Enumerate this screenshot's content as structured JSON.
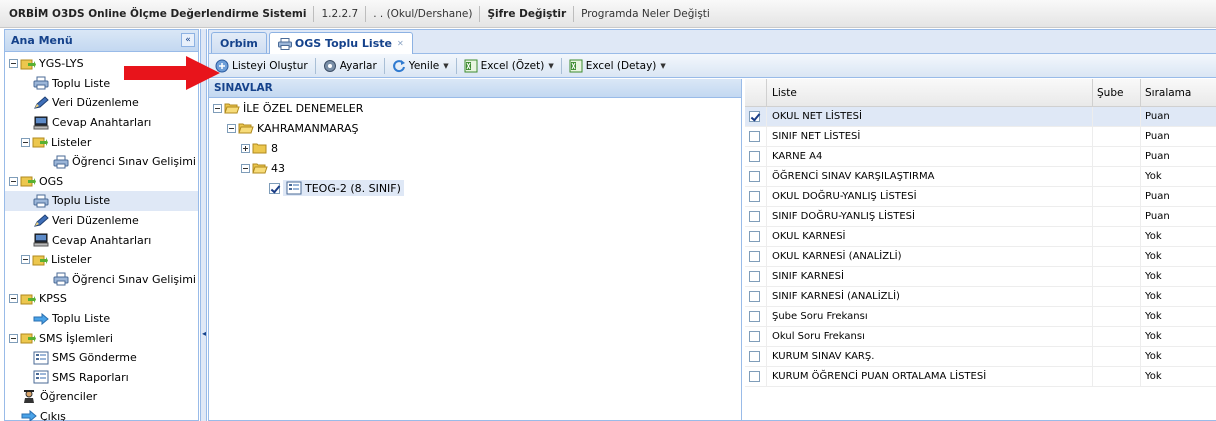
{
  "topbar": {
    "app_title": "ORBİM O3DS Online Ölçme Değerlendirme Sistemi",
    "version": "1.2.2.7",
    "org": ". . (Okul/Dershane)",
    "change_password": "Şifre Değiştir",
    "whats_new": "Programda Neler Değişti"
  },
  "left": {
    "title": "Ana Menü",
    "collapse": "«",
    "items": [
      {
        "label": "YGS-LYS"
      },
      {
        "label": "Toplu Liste"
      },
      {
        "label": "Veri Düzenleme"
      },
      {
        "label": "Cevap Anahtarları"
      },
      {
        "label": "Listeler"
      },
      {
        "label": "Öğrenci Sınav Gelişimi"
      },
      {
        "label": "OGS"
      },
      {
        "label": "Toplu Liste"
      },
      {
        "label": "Veri Düzenleme"
      },
      {
        "label": "Cevap Anahtarları"
      },
      {
        "label": "Listeler"
      },
      {
        "label": "Öğrenci Sınav Gelişimi"
      },
      {
        "label": "KPSS"
      },
      {
        "label": "Toplu Liste"
      },
      {
        "label": "SMS İşlemleri"
      },
      {
        "label": "SMS Gönderme"
      },
      {
        "label": "SMS Raporları"
      },
      {
        "label": "Öğrenciler"
      },
      {
        "label": "Çıkış"
      }
    ]
  },
  "tabs": [
    {
      "label": "Orbim"
    },
    {
      "label": "OGS Toplu Liste",
      "close": "✕"
    }
  ],
  "toolbar": {
    "create_list": "Listeyi Oluştur",
    "settings": "Ayarlar",
    "refresh": "Yenile",
    "excel_summary": "Excel (Özet)",
    "excel_detail": "Excel (Detay)"
  },
  "sinavlar": {
    "title": "SINAVLAR",
    "nodes": [
      {
        "label": "İLE ÖZEL DENEMELER"
      },
      {
        "label": "KAHRAMANMARAŞ"
      },
      {
        "label": "8"
      },
      {
        "label": "43"
      },
      {
        "label": "TEOG-2 (8. SINIF)"
      }
    ]
  },
  "grid": {
    "headers": {
      "liste": "Liste",
      "sube": "Şube",
      "siralama": "Sıralama"
    },
    "rows": [
      {
        "liste": "OKUL NET LİSTESİ",
        "sube": "",
        "siralama": "Puan",
        "checked": true
      },
      {
        "liste": "SINIF NET LİSTESİ",
        "sube": "",
        "siralama": "Puan",
        "checked": false
      },
      {
        "liste": "KARNE A4",
        "sube": "",
        "siralama": "Puan",
        "checked": false
      },
      {
        "liste": "ÖĞRENCİ SINAV KARŞILAŞTIRMA",
        "sube": "",
        "siralama": "Yok",
        "checked": false
      },
      {
        "liste": "OKUL DOĞRU-YANLIŞ LİSTESİ",
        "sube": "",
        "siralama": "Puan",
        "checked": false
      },
      {
        "liste": "SINIF DOĞRU-YANLIŞ LİSTESİ",
        "sube": "",
        "siralama": "Puan",
        "checked": false
      },
      {
        "liste": "OKUL KARNESİ",
        "sube": "",
        "siralama": "Yok",
        "checked": false
      },
      {
        "liste": "OKUL KARNESİ (ANALİZLİ)",
        "sube": "",
        "siralama": "Yok",
        "checked": false
      },
      {
        "liste": "SINIF KARNESİ",
        "sube": "",
        "siralama": "Yok",
        "checked": false
      },
      {
        "liste": "SINIF KARNESİ (ANALİZLİ)",
        "sube": "",
        "siralama": "Yok",
        "checked": false
      },
      {
        "liste": "Şube Soru Frekansı",
        "sube": "",
        "siralama": "Yok",
        "checked": false
      },
      {
        "liste": "Okul Soru Frekansı",
        "sube": "",
        "siralama": "Yok",
        "checked": false
      },
      {
        "liste": "KURUM SINAV KARŞ.",
        "sube": "",
        "siralama": "Yok",
        "checked": false
      },
      {
        "liste": "KURUM ÖĞRENCİ PUAN ORTALAMA LİSTESİ",
        "sube": "",
        "siralama": "Yok",
        "checked": false
      }
    ]
  },
  "colors": {
    "accent": "#15428b",
    "panel_border": "#99bbe8",
    "selection": "#dfe8f6",
    "arrow": "#e8141b"
  }
}
